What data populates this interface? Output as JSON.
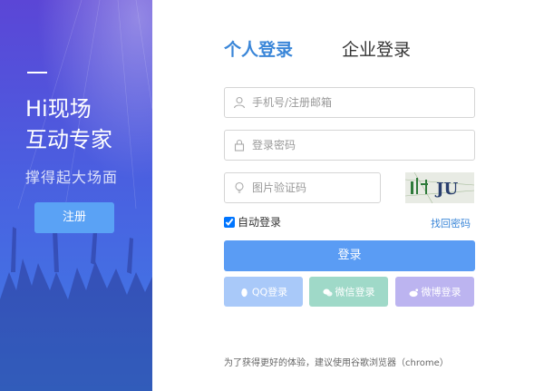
{
  "promo": {
    "slogan_line1": "Hi现场",
    "slogan_line2": "互动专家",
    "tagline": "撑得起大场面",
    "register_label": "注册"
  },
  "tabs": {
    "personal": "个人登录",
    "enterprise": "企业登录"
  },
  "form": {
    "account_placeholder": "手机号/注册邮箱",
    "password_placeholder": "登录密码",
    "captcha_placeholder": "图片验证码",
    "captcha_text": "JU",
    "remember_label": "自动登录",
    "remember_checked": true,
    "forgot_label": "找回密码",
    "login_label": "登录"
  },
  "social": {
    "qq_label": "QQ登录",
    "wechat_label": "微信登录",
    "weibo_label": "微博登录"
  },
  "footer": {
    "tip": "为了获得更好的体验，建议使用谷歌浏览器（chrome）"
  },
  "colors": {
    "accent": "#3a86d8",
    "login_button": "#5a9cf4",
    "register_button": "#5aa2f5",
    "qq": "#a9c9f9",
    "wechat": "#9fd9c8",
    "weibo": "#bcb4f0"
  },
  "icons": {
    "account": "user-icon",
    "password": "lock-icon",
    "captcha": "bulb-icon",
    "qq": "qq-icon",
    "wechat": "wechat-icon",
    "weibo": "weibo-icon"
  }
}
